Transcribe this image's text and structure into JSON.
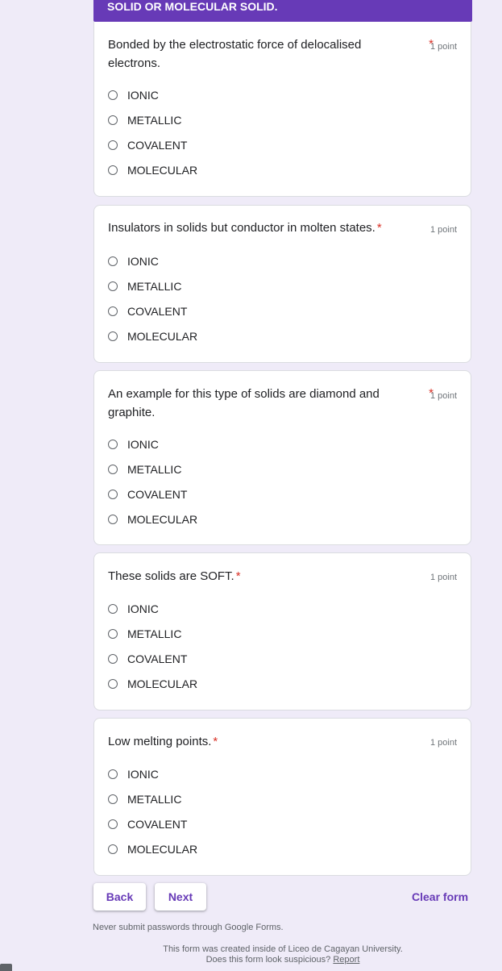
{
  "header": {
    "title": "SOLID OR MOLECULAR SOLID."
  },
  "questions": [
    {
      "title": "Bonded by the electrostatic force of delocalised electrons.",
      "required": "*",
      "points": "1 point",
      "options": [
        "IONIC",
        "METALLIC",
        "COVALENT",
        "MOLECULAR"
      ]
    },
    {
      "title": "Insulators in solids but conductor in molten states.",
      "required": "*",
      "points": "1 point",
      "options": [
        "IONIC",
        "METALLIC",
        "COVALENT",
        "MOLECULAR"
      ]
    },
    {
      "title": "An example for this type of solids are diamond and graphite.",
      "required": "*",
      "points": "1 point",
      "options": [
        "IONIC",
        "METALLIC",
        "COVALENT",
        "MOLECULAR"
      ]
    },
    {
      "title": "These solids are SOFT.",
      "required": "*",
      "points": "1 point",
      "options": [
        "IONIC",
        "METALLIC",
        "COVALENT",
        "MOLECULAR"
      ]
    },
    {
      "title": "Low melting points.",
      "required": "*",
      "points": "1 point",
      "options": [
        "IONIC",
        "METALLIC",
        "COVALENT",
        "MOLECULAR"
      ]
    }
  ],
  "nav": {
    "back": "Back",
    "next": "Next",
    "clear": "Clear form"
  },
  "footer": {
    "warning": "Never submit passwords through Google Forms.",
    "created": "This form was created inside of Liceo de Cagayan University.",
    "suspicious": "Does this form look suspicious?",
    "report": "Report"
  }
}
